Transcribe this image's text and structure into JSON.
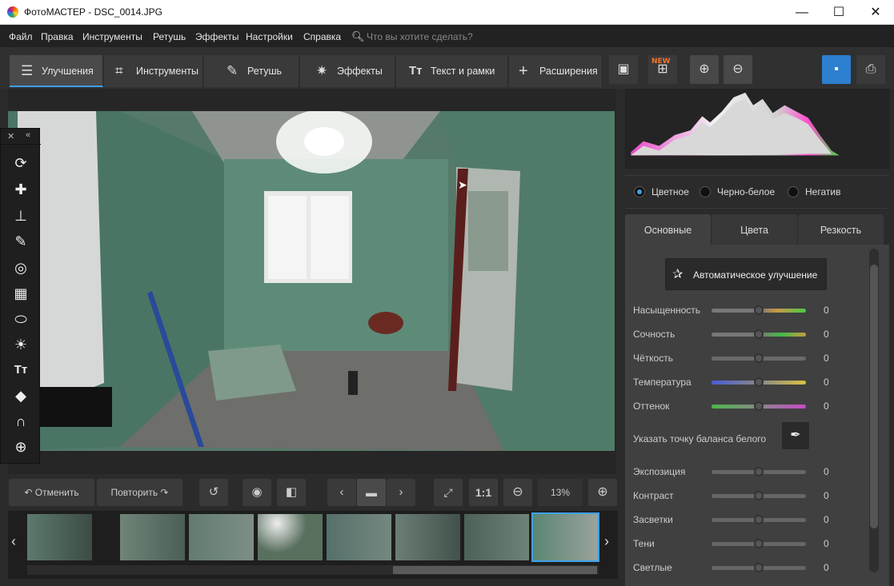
{
  "window": {
    "title": "ФотоМАСТЕР - DSC_0014.JPG",
    "minimize": "—",
    "maximize": "☐",
    "close": "✕"
  },
  "menu": {
    "items": [
      "Файл",
      "Правка",
      "Инструменты",
      "Ретушь",
      "Эффекты",
      "Настройки",
      "Справка"
    ],
    "search_placeholder": "Что вы хотите сделать?"
  },
  "tabs": [
    {
      "label": "Улучшения",
      "icon": "sliders-icon"
    },
    {
      "label": "Инструменты",
      "icon": "crop-icon"
    },
    {
      "label": "Ретушь",
      "icon": "brush-icon"
    },
    {
      "label": "Эффекты",
      "icon": "magic-wand-icon"
    },
    {
      "label": "Текст и рамки",
      "icon": "text-icon"
    },
    {
      "label": "Расширения",
      "icon": "plus-icon"
    }
  ],
  "new_badge": "NEW",
  "bottom": {
    "undo": "Отменить",
    "redo": "Повторить",
    "one_to_one": "1:1",
    "zoom": "13%"
  },
  "color_modes": [
    "Цветное",
    "Черно-белое",
    "Негатив"
  ],
  "panel_tabs": [
    "Основные",
    "Цвета",
    "Резкость"
  ],
  "auto_enhance": "Автоматическое улучшение",
  "white_balance": "Указать точку баланса белого",
  "sliders_top": [
    {
      "label": "Насыщенность",
      "value": "0"
    },
    {
      "label": "Сочность",
      "value": "0"
    },
    {
      "label": "Чёткость",
      "value": "0"
    },
    {
      "label": "Температура",
      "value": "0"
    },
    {
      "label": "Оттенок",
      "value": "0"
    }
  ],
  "sliders_bottom": [
    {
      "label": "Экспозиция",
      "value": "0"
    },
    {
      "label": "Контраст",
      "value": "0"
    },
    {
      "label": "Засветки",
      "value": "0"
    },
    {
      "label": "Тени",
      "value": "0"
    },
    {
      "label": "Светлые",
      "value": "0"
    }
  ],
  "colors": {
    "accent": "#3ea0e6",
    "save": "#2d7fcf",
    "wall": "#4f7d6c"
  }
}
